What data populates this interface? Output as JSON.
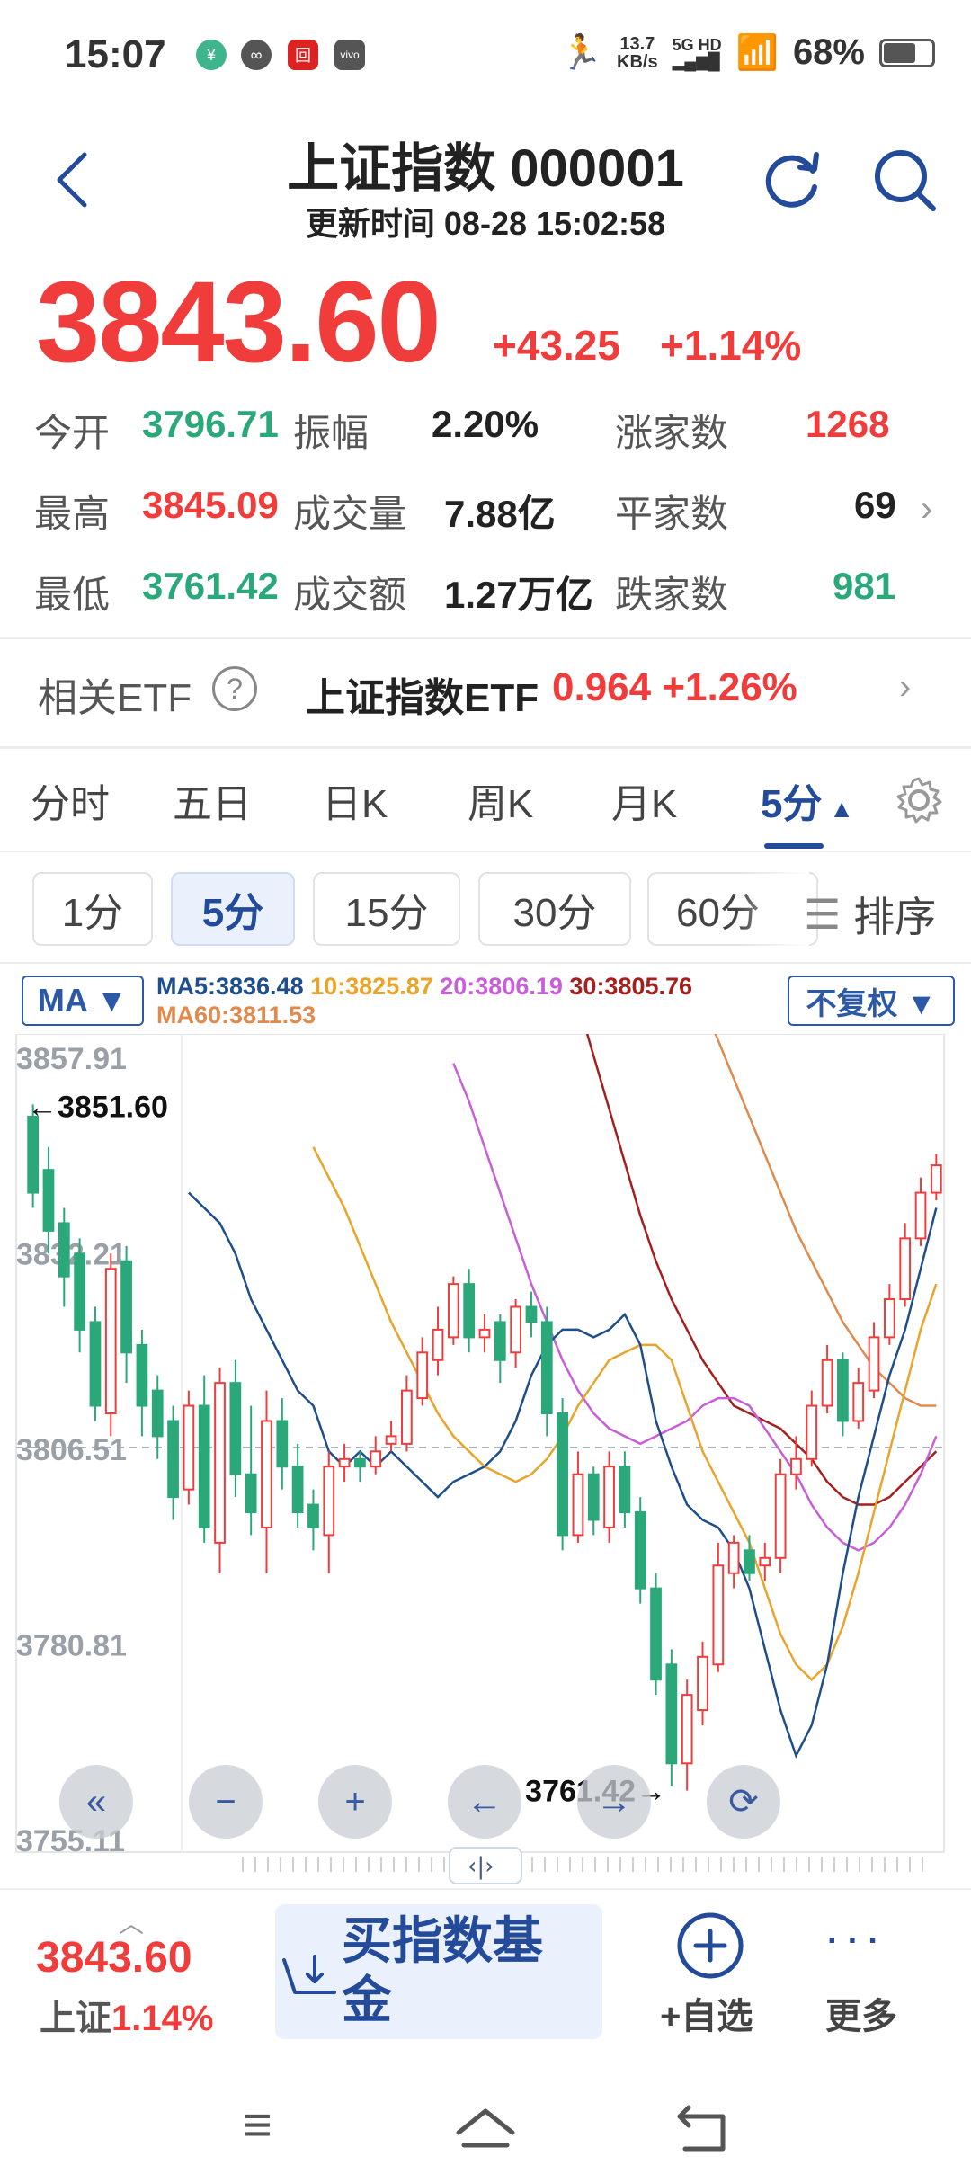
{
  "status_bar": {
    "time": "15:07",
    "net_speed_top": "13.7",
    "net_speed_bottom": "KB/s",
    "net_type": "5G HD",
    "battery_pct": "68%",
    "battery_level": 0.68
  },
  "header": {
    "title": "上证指数 000001",
    "update_time": "更新时间 08-28 15:02:58"
  },
  "quote": {
    "price": "3843.60",
    "change": "+43.25",
    "change_pct": "+1.14%"
  },
  "stats": [
    {
      "label": "今开",
      "value": "3796.71",
      "color": "green"
    },
    {
      "label": "振幅",
      "value": "2.20%",
      "color": "dark"
    },
    {
      "label": "涨家数",
      "value": "1268",
      "color": "red"
    },
    {
      "label": "最高",
      "value": "3845.09",
      "color": "red"
    },
    {
      "label": "成交量",
      "value": "7.88亿",
      "color": "dark"
    },
    {
      "label": "平家数",
      "value": "69",
      "color": "dark"
    },
    {
      "label": "最低",
      "value": "3761.42",
      "color": "green"
    },
    {
      "label": "成交额",
      "value": "1.27万亿",
      "color": "dark"
    },
    {
      "label": "跌家数",
      "value": "981",
      "color": "green"
    }
  ],
  "etf": {
    "label": "相关ETF",
    "name": "上证指数ETF",
    "value": "0.964 +1.26%"
  },
  "tabs": [
    "分时",
    "五日",
    "日K",
    "周K",
    "月K",
    "5分"
  ],
  "active_tab": "5分",
  "intervals": [
    "1分",
    "5分",
    "15分",
    "30分",
    "60分"
  ],
  "active_interval": "5分",
  "sort_label": "排序",
  "chart_header": {
    "ma_button": "MA ▼",
    "adjust_button": "不复权 ▼",
    "ma5": "MA5:3836.48",
    "ma10": "10:3825.87",
    "ma20": "20:3806.19",
    "ma30": "30:3805.76",
    "ma60": "MA60:3811.53"
  },
  "colors": {
    "up": "#f13c3c",
    "down": "#2aa87a",
    "accent": "#234b9a",
    "ma5": "#1f4e8c",
    "ma10": "#e8a42b",
    "ma20": "#c85fd8",
    "ma30": "#a51f1f",
    "ma60": "#e08a4c"
  },
  "chart_data": {
    "type": "candlestick",
    "y_ticks": [
      "3857.91",
      "3832.21",
      "3806.51",
      "3780.81",
      "3755.11"
    ],
    "ylim": [
      3755.11,
      3857.91
    ],
    "high_label": "←3851.60",
    "low_label": "3761.42→",
    "candles": [
      {
        "o": 3850,
        "c": 3840,
        "h": 3851.6,
        "l": 3838
      },
      {
        "o": 3843,
        "c": 3835,
        "h": 3846,
        "l": 3832
      },
      {
        "o": 3836,
        "c": 3829,
        "h": 3838,
        "l": 3825
      },
      {
        "o": 3832,
        "c": 3822,
        "h": 3834,
        "l": 3819
      },
      {
        "o": 3823,
        "c": 3812,
        "h": 3825,
        "l": 3810
      },
      {
        "o": 3811,
        "c": 3830,
        "h": 3832,
        "l": 3808
      },
      {
        "o": 3831,
        "c": 3819,
        "h": 3833,
        "l": 3815
      },
      {
        "o": 3820,
        "c": 3812,
        "h": 3822,
        "l": 3808
      },
      {
        "o": 3814,
        "c": 3808,
        "h": 3816,
        "l": 3805
      },
      {
        "o": 3810,
        "c": 3800,
        "h": 3812,
        "l": 3797
      },
      {
        "o": 3801,
        "c": 3812,
        "h": 3814,
        "l": 3799
      },
      {
        "o": 3812,
        "c": 3796,
        "h": 3816,
        "l": 3794
      },
      {
        "o": 3794,
        "c": 3815,
        "h": 3817,
        "l": 3790
      },
      {
        "o": 3815,
        "c": 3803,
        "h": 3818,
        "l": 3800
      },
      {
        "o": 3803,
        "c": 3798,
        "h": 3812,
        "l": 3795
      },
      {
        "o": 3796,
        "c": 3810,
        "h": 3814,
        "l": 3790
      },
      {
        "o": 3810,
        "c": 3804,
        "h": 3813,
        "l": 3801
      },
      {
        "o": 3804,
        "c": 3798,
        "h": 3807,
        "l": 3796
      },
      {
        "o": 3799,
        "c": 3796,
        "h": 3801,
        "l": 3793
      },
      {
        "o": 3795,
        "c": 3804,
        "h": 3806,
        "l": 3790
      },
      {
        "o": 3804,
        "c": 3805,
        "h": 3807,
        "l": 3802
      },
      {
        "o": 3805,
        "c": 3804,
        "h": 3806,
        "l": 3802
      },
      {
        "o": 3804,
        "c": 3806,
        "h": 3808,
        "l": 3803
      },
      {
        "o": 3807,
        "c": 3808,
        "h": 3810,
        "l": 3806
      },
      {
        "o": 3807,
        "c": 3814,
        "h": 3816,
        "l": 3806
      },
      {
        "o": 3813,
        "c": 3819,
        "h": 3821,
        "l": 3812
      },
      {
        "o": 3818,
        "c": 3822,
        "h": 3825,
        "l": 3816
      },
      {
        "o": 3821,
        "c": 3828,
        "h": 3829,
        "l": 3820
      },
      {
        "o": 3828,
        "c": 3821,
        "h": 3830,
        "l": 3819
      },
      {
        "o": 3821,
        "c": 3822,
        "h": 3824,
        "l": 3819
      },
      {
        "o": 3823,
        "c": 3818,
        "h": 3824,
        "l": 3815
      },
      {
        "o": 3819,
        "c": 3825,
        "h": 3826,
        "l": 3817
      },
      {
        "o": 3825,
        "c": 3823,
        "h": 3827,
        "l": 3821
      },
      {
        "o": 3823,
        "c": 3811,
        "h": 3825,
        "l": 3808
      },
      {
        "o": 3811,
        "c": 3795,
        "h": 3813,
        "l": 3793
      },
      {
        "o": 3795,
        "c": 3803,
        "h": 3806,
        "l": 3794
      },
      {
        "o": 3803,
        "c": 3797,
        "h": 3804,
        "l": 3795
      },
      {
        "o": 3796,
        "c": 3804,
        "h": 3806,
        "l": 3794
      },
      {
        "o": 3804,
        "c": 3798,
        "h": 3806,
        "l": 3796
      },
      {
        "o": 3798,
        "c": 3788,
        "h": 3800,
        "l": 3786
      },
      {
        "o": 3788,
        "c": 3776,
        "h": 3790,
        "l": 3774
      },
      {
        "o": 3778,
        "c": 3765,
        "h": 3780,
        "l": 3762
      },
      {
        "o": 3765,
        "c": 3774,
        "h": 3776,
        "l": 3761.42
      },
      {
        "o": 3772,
        "c": 3779,
        "h": 3781,
        "l": 3770
      },
      {
        "o": 3778,
        "c": 3791,
        "h": 3794,
        "l": 3777
      },
      {
        "o": 3790,
        "c": 3794,
        "h": 3795,
        "l": 3788
      },
      {
        "o": 3793,
        "c": 3790,
        "h": 3795,
        "l": 3789
      },
      {
        "o": 3791,
        "c": 3792,
        "h": 3794,
        "l": 3789
      },
      {
        "o": 3792,
        "c": 3803,
        "h": 3805,
        "l": 3790
      },
      {
        "o": 3803,
        "c": 3805,
        "h": 3808,
        "l": 3801
      },
      {
        "o": 3805,
        "c": 3812,
        "h": 3814,
        "l": 3804
      },
      {
        "o": 3812,
        "c": 3818,
        "h": 3820,
        "l": 3811
      },
      {
        "o": 3818,
        "c": 3810,
        "h": 3819,
        "l": 3808
      },
      {
        "o": 3810,
        "c": 3815,
        "h": 3817,
        "l": 3809
      },
      {
        "o": 3814,
        "c": 3821,
        "h": 3823,
        "l": 3813
      },
      {
        "o": 3821,
        "c": 3826,
        "h": 3828,
        "l": 3820
      },
      {
        "o": 3826,
        "c": 3834,
        "h": 3836,
        "l": 3825
      },
      {
        "o": 3834,
        "c": 3840,
        "h": 3842,
        "l": 3833
      },
      {
        "o": 3840,
        "c": 3843.6,
        "h": 3845.09,
        "l": 3839
      }
    ],
    "ma5": [
      3840,
      3838,
      3836,
      3832,
      3826,
      3822,
      3818,
      3814,
      3812,
      3806,
      3804,
      3806,
      3804,
      3806,
      3804,
      3802,
      3800,
      3802,
      3803,
      3804,
      3806,
      3810,
      3816,
      3820,
      3822,
      3822,
      3821,
      3822,
      3824,
      3820,
      3810,
      3804,
      3799,
      3797,
      3796,
      3793,
      3788,
      3780,
      3772,
      3766,
      3770,
      3778,
      3790,
      3800,
      3808,
      3816,
      3822,
      3830,
      3838
    ],
    "ma10": [
      3846,
      3842,
      3838,
      3833,
      3828,
      3823,
      3819,
      3815,
      3811,
      3808,
      3806,
      3804,
      3803,
      3802,
      3803,
      3805,
      3808,
      3812,
      3815,
      3818,
      3819,
      3820,
      3820,
      3818,
      3812,
      3806,
      3802,
      3798,
      3794,
      3788,
      3782,
      3778,
      3776,
      3778,
      3783,
      3790,
      3798,
      3806,
      3814,
      3822,
      3828
    ],
    "ma20": [
      3857,
      3852,
      3846,
      3840,
      3834,
      3828,
      3823,
      3818,
      3814,
      3811,
      3809,
      3808,
      3807,
      3808,
      3809,
      3810,
      3812,
      3813,
      3813,
      3812,
      3809,
      3806,
      3803,
      3799,
      3796,
      3794,
      3793,
      3794,
      3796,
      3799,
      3803,
      3808
    ],
    "ma30": [
      3865,
      3858,
      3851,
      3844,
      3837,
      3831,
      3826,
      3822,
      3818,
      3815,
      3812,
      3811,
      3810,
      3809,
      3807,
      3805,
      3802,
      3800,
      3799,
      3799,
      3800,
      3802,
      3804,
      3806
    ],
    "ma60": [
      3865,
      3860,
      3855,
      3850,
      3845,
      3840,
      3835,
      3831,
      3827,
      3823,
      3820,
      3817,
      3815,
      3813,
      3812,
      3812
    ]
  },
  "chart_controls": [
    "«",
    "−",
    "+",
    "←",
    "→",
    "⟳"
  ],
  "bottom": {
    "price": "3843.60",
    "name": "上证",
    "pct": "1.14%",
    "buy_label": "买指数基金",
    "add_label": "+自选",
    "more_label": "更多"
  }
}
